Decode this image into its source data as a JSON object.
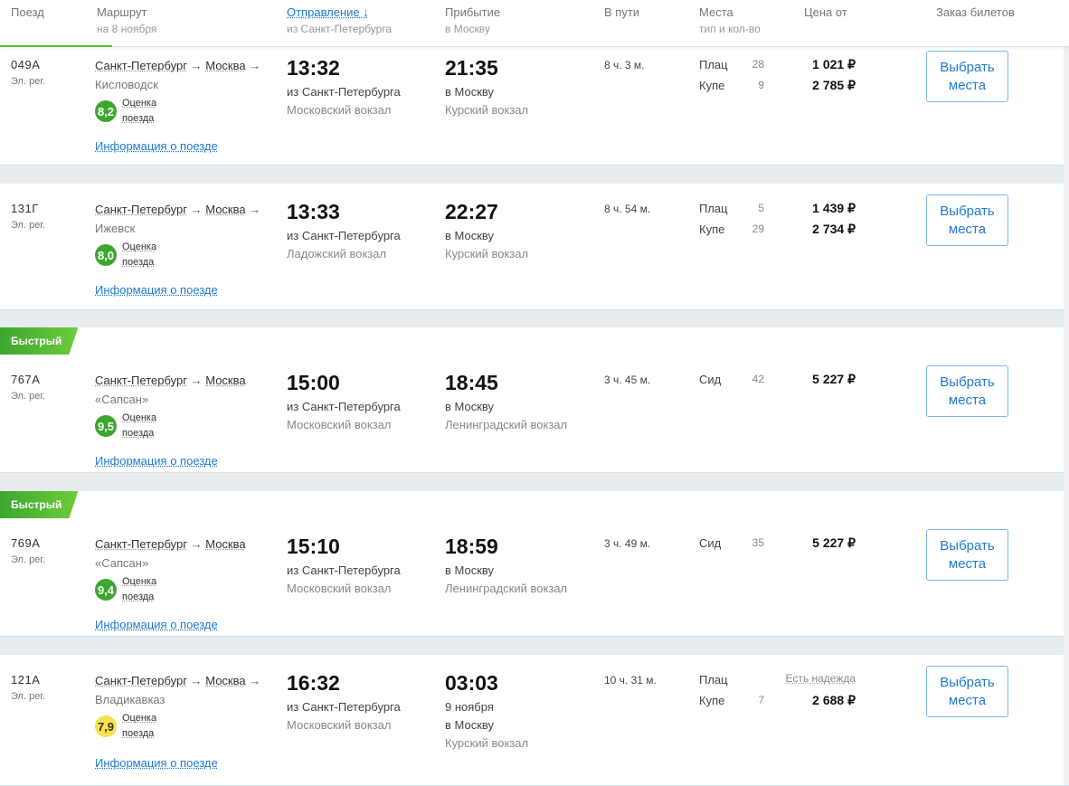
{
  "header": {
    "train": "Поезд",
    "route": "Маршрут",
    "route_date": "на 8 ноября",
    "departure": "Отправление ↓",
    "departure_sub": "из Санкт-Петербурга",
    "arrival": "Прибытие",
    "arrival_sub": "в Москву",
    "duration": "В пути",
    "seats": "Места",
    "seats_sub": "тип и кол-во",
    "price": "Цена от",
    "order": "Заказ билетов"
  },
  "rating_label_1": "Оценка",
  "rating_label_2": "поезда",
  "info_link": "Информация о поезде",
  "button_label_1": "Выбрать",
  "button_label_2": "места",
  "fast_badge": "Быстрый",
  "trains": [
    {
      "number": "049А",
      "type": "Эл. рег.",
      "from": "Санкт-Петербург",
      "to": "Москва",
      "dest": "Кисловодск",
      "rating": "8,2",
      "dep_time": "13:32",
      "dep_from": "из Санкт-Петербурга",
      "dep_station": "Московский вокзал",
      "arr_time": "21:35",
      "arr_to": "в Москву",
      "arr_station": "Курский вокзал",
      "duration": "8 ч. 3 м.",
      "seats": [
        {
          "type": "Плац",
          "count": "28",
          "price": "1 021 ₽"
        },
        {
          "type": "Купе",
          "count": "9",
          "price": "2 785 ₽"
        }
      ]
    },
    {
      "number": "131Г",
      "type": "Эл. рег.",
      "from": "Санкт-Петербург",
      "to": "Москва",
      "dest": "Ижевск",
      "rating": "8,0",
      "dep_time": "13:33",
      "dep_from": "из Санкт-Петербурга",
      "dep_station": "Ладожский вокзал",
      "arr_time": "22:27",
      "arr_to": "в Москву",
      "arr_station": "Курский вокзал",
      "duration": "8 ч. 54 м.",
      "seats": [
        {
          "type": "Плац",
          "count": "5",
          "price": "1 439 ₽"
        },
        {
          "type": "Купе",
          "count": "29",
          "price": "2 734 ₽"
        }
      ]
    },
    {
      "number": "767А",
      "type": "Эл. рег.",
      "from": "Санкт-Петербург",
      "to": "Москва",
      "dest": "«Сапсан»",
      "rating": "9,5",
      "dep_time": "15:00",
      "dep_from": "из Санкт-Петербурга",
      "dep_station": "Московский вокзал",
      "arr_time": "18:45",
      "arr_to": "в Москву",
      "arr_station": "Ленинградский вокзал",
      "duration": "3 ч. 45 м.",
      "seats": [
        {
          "type": "Сид",
          "count": "42",
          "price": "5 227 ₽"
        }
      ]
    },
    {
      "number": "769А",
      "type": "Эл. рег.",
      "from": "Санкт-Петербург",
      "to": "Москва",
      "dest": "«Сапсан»",
      "rating": "9,4",
      "dep_time": "15:10",
      "dep_from": "из Санкт-Петербурга",
      "dep_station": "Московский вокзал",
      "arr_time": "18:59",
      "arr_to": "в Москву",
      "arr_station": "Ленинградский вокзал",
      "duration": "3 ч. 49 м.",
      "seats": [
        {
          "type": "Сид",
          "count": "35",
          "price": "5 227 ₽"
        }
      ]
    },
    {
      "number": "121А",
      "type": "Эл. рег.",
      "from": "Санкт-Петербург",
      "to": "Москва",
      "dest": "Владикавказ",
      "rating": "7,9",
      "dep_time": "16:32",
      "dep_from": "из Санкт-Петербурга",
      "dep_station": "Московский вокзал",
      "arr_time": "03:03",
      "arr_date": "9 ноября",
      "arr_to": "в Москву",
      "arr_station": "Курский вокзал",
      "duration": "10 ч. 31 м.",
      "seats": [
        {
          "type": "Плац",
          "count": "",
          "price": "Есть надежда"
        },
        {
          "type": "Купе",
          "count": "7",
          "price": "2 688 ₽"
        }
      ]
    }
  ],
  "colors": {
    "accent": "#1f7ad1",
    "rating_green": "#3da62f",
    "rating_yellow": "#f5e34a",
    "badge_green": "#5bbc2d"
  }
}
